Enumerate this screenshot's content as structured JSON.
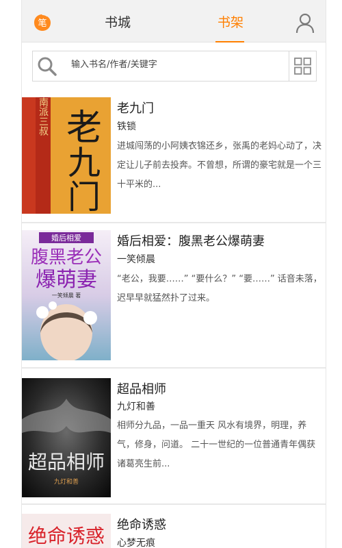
{
  "header": {
    "tabs": [
      {
        "label": "书城",
        "active": false
      },
      {
        "label": "书架",
        "active": true
      }
    ],
    "accent_color": "#ff7f00",
    "icons": [
      "logo-icon",
      "user-icon"
    ]
  },
  "search": {
    "placeholder": "输入书名/作者/关键字",
    "icons": [
      "search-icon",
      "grid-icon"
    ]
  },
  "books": [
    {
      "title": "老九门",
      "author": "铁锁",
      "description": "进城闯荡的小阿姨衣锦还乡，张禹的老妈心动了，决定让儿子前去投奔。不曾想，所谓的豪宅就是一个三十平米的...",
      "cover_text": "老九门",
      "cover_side_text": "南派三叔"
    },
    {
      "title": "婚后相爱：腹黑老公爆萌妻",
      "author": "一笑倾晨",
      "description": "“老公，我要……” “要什么？” “要……” 话音未落，迟早早就猛然扑了过来。",
      "cover_text_1": "腹黑老公",
      "cover_text_2": "爆萌妻",
      "cover_banner": "婚后相爱",
      "cover_author": "一笑倾晨 著"
    },
    {
      "title": "超品相师",
      "author": "九灯和善",
      "description": "相师分九品，一品一重天 风水有境界，明理，养气，修身，问道。 二十一世纪的一位普通青年偶获诸葛亮生前...",
      "cover_text": "超品相师",
      "cover_author": "九灯和善"
    },
    {
      "title": "绝命诱惑",
      "author": "心梦无痕",
      "description": "",
      "cover_text": "绝命诱惑"
    }
  ]
}
